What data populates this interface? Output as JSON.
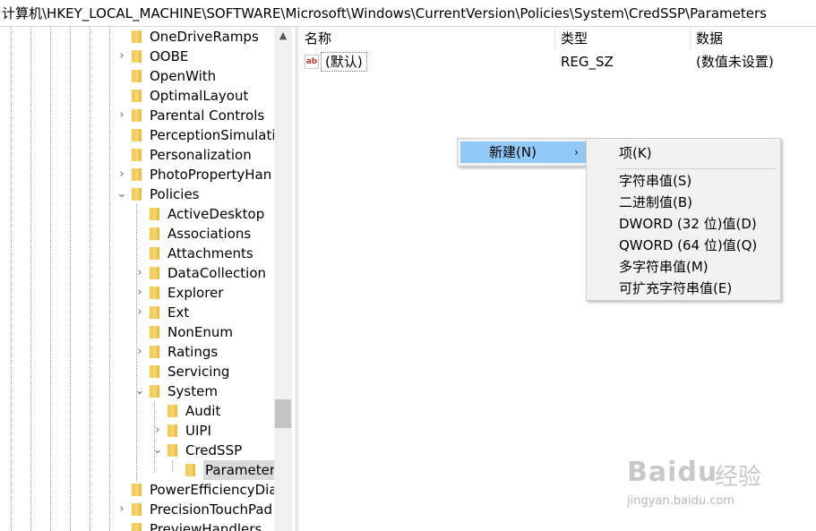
{
  "address_bar": {
    "path": "计算机\\HKEY_LOCAL_MACHINE\\SOFTWARE\\Microsoft\\Windows\\CurrentVersion\\Policies\\System\\CredSSP\\Parameters"
  },
  "tree": {
    "items": [
      {
        "label": "OneDriveRamps",
        "expander": "",
        "selected": false
      },
      {
        "label": "OOBE",
        "expander": "›",
        "selected": false
      },
      {
        "label": "OpenWith",
        "expander": "",
        "selected": false
      },
      {
        "label": "OptimalLayout",
        "expander": "",
        "selected": false
      },
      {
        "label": "Parental Controls",
        "expander": "›",
        "selected": false
      },
      {
        "label": "PerceptionSimulati",
        "expander": "",
        "selected": false
      },
      {
        "label": "Personalization",
        "expander": "",
        "selected": false
      },
      {
        "label": "PhotoPropertyHan",
        "expander": "›",
        "selected": false
      },
      {
        "label": "Policies",
        "expander": "⌄",
        "selected": false
      },
      {
        "label": "ActiveDesktop",
        "expander": "",
        "selected": false
      },
      {
        "label": "Associations",
        "expander": "",
        "selected": false
      },
      {
        "label": "Attachments",
        "expander": "",
        "selected": false
      },
      {
        "label": "DataCollection",
        "expander": "›",
        "selected": false
      },
      {
        "label": "Explorer",
        "expander": "›",
        "selected": false
      },
      {
        "label": "Ext",
        "expander": "›",
        "selected": false
      },
      {
        "label": "NonEnum",
        "expander": "",
        "selected": false
      },
      {
        "label": "Ratings",
        "expander": "›",
        "selected": false
      },
      {
        "label": "Servicing",
        "expander": "",
        "selected": false
      },
      {
        "label": "System",
        "expander": "⌄",
        "selected": false
      },
      {
        "label": "Audit",
        "expander": "",
        "selected": false
      },
      {
        "label": "UIPI",
        "expander": "›",
        "selected": false
      },
      {
        "label": "CredSSP",
        "expander": "⌄",
        "selected": false
      },
      {
        "label": "Parameters",
        "expander": "",
        "selected": true
      },
      {
        "label": "PowerEfficiencyDia",
        "expander": "",
        "selected": false
      },
      {
        "label": "PrecisionTouchPad",
        "expander": "›",
        "selected": false
      },
      {
        "label": "PreviewHandlers",
        "expander": "",
        "selected": false
      }
    ]
  },
  "values_pane": {
    "headers": {
      "name": "名称",
      "type": "类型",
      "data": "数据"
    },
    "rows": [
      {
        "icon": "reg-sz-icon",
        "icon_text": "ab",
        "name": "(默认)",
        "type": "REG_SZ",
        "data": "(数值未设置)"
      }
    ]
  },
  "context_menu": {
    "new_label": "新建(N)",
    "arrow": "›",
    "submenu": [
      "项(K)",
      "字符串值(S)",
      "二进制值(B)",
      "DWORD (32 位)值(D)",
      "QWORD (64 位)值(Q)",
      "多字符串值(M)",
      "可扩充字符串值(E)"
    ]
  },
  "watermark": {
    "brand": "Baidu",
    "product": "经验",
    "url": "jingyan.baidu.com"
  },
  "colors": {
    "menu_highlight": "#91c9f7",
    "menu_bg": "#f2f2f2",
    "folder": "#f3c84a",
    "selection": "#d9d9d9"
  }
}
